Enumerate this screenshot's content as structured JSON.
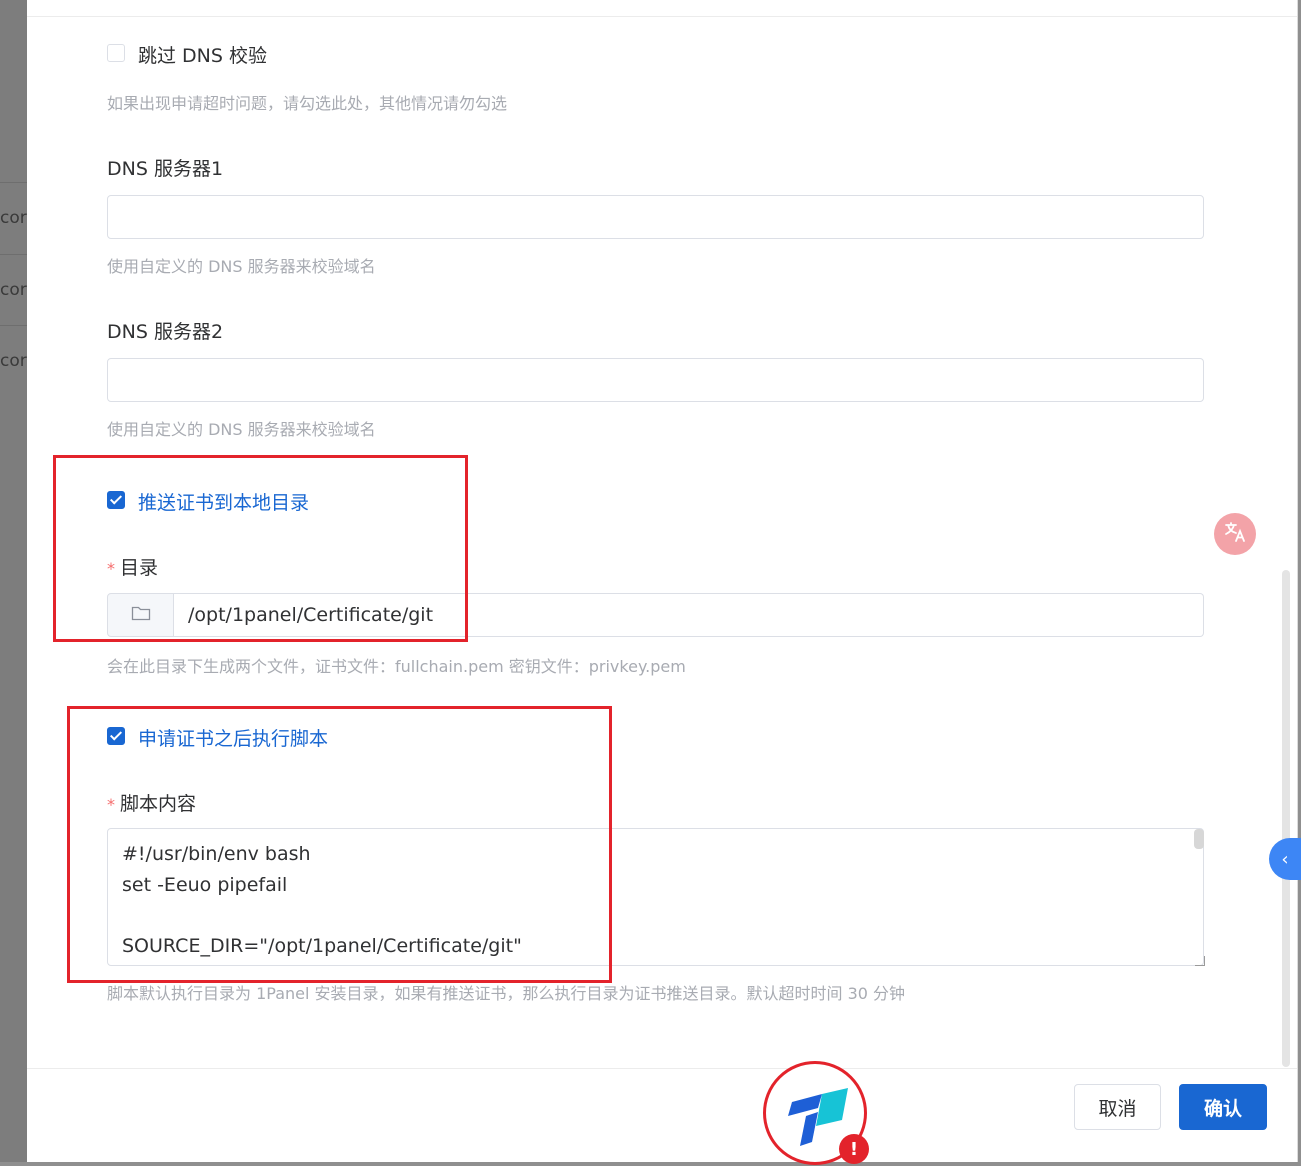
{
  "backdrop": {
    "rows": [
      "cor",
      "cor",
      "cor"
    ]
  },
  "form": {
    "skip_dns": {
      "label": "跳过 DNS 校验",
      "checked": false,
      "hint": "如果出现申请超时问题，请勾选此处，其他情况请勿勾选"
    },
    "dns_server1": {
      "label": "DNS 服务器1",
      "value": "",
      "hint": "使用自定义的 DNS 服务器来校验域名"
    },
    "dns_server2": {
      "label": "DNS 服务器2",
      "value": "",
      "hint": "使用自定义的 DNS 服务器来校验域名"
    },
    "push_local": {
      "label": "推送证书到本地目录",
      "checked": true
    },
    "directory": {
      "required_mark": "*",
      "label": "目录",
      "value": "/opt/1panel/Certificate/git",
      "hint": "会在此目录下生成两个文件，证书文件：fullchain.pem 密钥文件：privkey.pem"
    },
    "exec_script": {
      "label": "申请证书之后执行脚本",
      "checked": true
    },
    "script_content": {
      "required_mark": "*",
      "label": "脚本内容",
      "value": "#!/usr/bin/env bash\nset -Eeuo pipefail\n\nSOURCE_DIR=\"/opt/1panel/Certificate/git\"",
      "hint": "脚本默认执行目录为 1Panel 安装目录，如果有推送证书，那么执行目录为证书推送目录。默认超时时间 30 分钟"
    }
  },
  "footer": {
    "cancel_label": "取消",
    "confirm_label": "确认"
  },
  "overlays": {
    "side_tab_glyph": "‹",
    "logo_alert_glyph": "!"
  },
  "colors": {
    "primary": "#1967d2",
    "highlight_box": "#e3232b",
    "required": "#f56c6c",
    "hint_text": "#a8abb2"
  }
}
